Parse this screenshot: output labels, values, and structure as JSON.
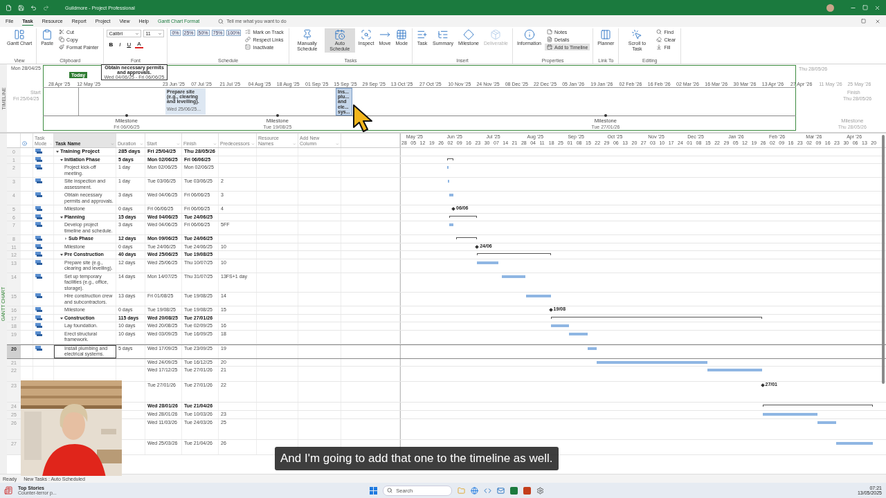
{
  "title_bar": {
    "title": "Guildmore - Project Professional"
  },
  "menu": [
    {
      "label": "File",
      "selected": false
    },
    {
      "label": "Task",
      "selected": true
    },
    {
      "label": "Resource",
      "selected": false
    },
    {
      "label": "Report",
      "selected": false
    },
    {
      "label": "Project",
      "selected": false
    },
    {
      "label": "View",
      "selected": false
    },
    {
      "label": "Help",
      "selected": false
    },
    {
      "label": "Gantt Chart Format",
      "selected": false
    }
  ],
  "tell_me": {
    "placeholder": "Tell me what you want to do"
  },
  "ribbon": [
    {
      "label": "View",
      "items": [
        {
          "kind": "large",
          "label": "Gantt Chart",
          "selected": false,
          "disabled": false
        }
      ]
    },
    {
      "label": "Clipboard",
      "items": [
        {
          "kind": "large",
          "label": "Paste",
          "selected": false,
          "disabled": false
        },
        {
          "kind": "small",
          "label": "Cut",
          "selected": false,
          "disabled": false
        },
        {
          "kind": "small",
          "label": "Copy",
          "selected": false,
          "disabled": false
        },
        {
          "kind": "small",
          "label": "Format Painter",
          "selected": false,
          "disabled": false
        }
      ]
    },
    {
      "label": "Font",
      "items": [
        {
          "kind": "field",
          "value": "Calibri"
        },
        {
          "kind": "field",
          "value": "11"
        },
        {
          "kind": "format",
          "label": "B"
        },
        {
          "kind": "format",
          "label": "I"
        },
        {
          "kind": "format",
          "label": "U"
        },
        {
          "kind": "format",
          "label": "A"
        }
      ]
    },
    {
      "label": "Schedule",
      "items": [
        {
          "kind": "pct",
          "label": "0%"
        },
        {
          "kind": "pct",
          "label": "25%"
        },
        {
          "kind": "pct",
          "label": "50%"
        },
        {
          "kind": "pct",
          "label": "75%"
        },
        {
          "kind": "pct",
          "label": "100%"
        },
        {
          "kind": "small",
          "label": "Mark on Track",
          "selected": false,
          "disabled": false
        },
        {
          "kind": "small",
          "label": "Respect Links",
          "selected": false,
          "disabled": false
        },
        {
          "kind": "small",
          "label": "Inactivate",
          "selected": false,
          "disabled": false
        }
      ]
    },
    {
      "label": "Tasks",
      "items": [
        {
          "kind": "large",
          "label": "Manually Schedule",
          "selected": false,
          "disabled": false
        },
        {
          "kind": "large",
          "label": "Auto Schedule",
          "selected": true,
          "disabled": false
        },
        {
          "kind": "large",
          "label": "Inspect",
          "selected": false,
          "disabled": false
        },
        {
          "kind": "large",
          "label": "Move",
          "selected": false,
          "disabled": false
        },
        {
          "kind": "large",
          "label": "Mode",
          "selected": false,
          "disabled": false
        }
      ]
    },
    {
      "label": "Insert",
      "items": [
        {
          "kind": "large",
          "label": "Task",
          "selected": false,
          "disabled": false
        },
        {
          "kind": "large",
          "label": "Summary",
          "selected": false,
          "disabled": false
        },
        {
          "kind": "large",
          "label": "Milestone",
          "selected": false,
          "disabled": false
        },
        {
          "kind": "large",
          "label": "Deliverable",
          "selected": false,
          "disabled": true
        }
      ]
    },
    {
      "label": "Properties",
      "items": [
        {
          "kind": "large",
          "label": "Information",
          "selected": false,
          "disabled": false
        },
        {
          "kind": "small",
          "label": "Notes",
          "selected": false,
          "disabled": false
        },
        {
          "kind": "small",
          "label": "Details",
          "selected": false,
          "disabled": false
        },
        {
          "kind": "small",
          "label": "Add to Timeline",
          "selected": true,
          "disabled": false
        }
      ]
    },
    {
      "label": "Link To",
      "items": [
        {
          "kind": "large",
          "label": "Planner",
          "selected": false,
          "disabled": false
        }
      ]
    },
    {
      "label": "Editing",
      "items": [
        {
          "kind": "large",
          "label": "Scroll to Task",
          "selected": false,
          "disabled": false
        },
        {
          "kind": "small",
          "label": "Find",
          "selected": false,
          "disabled": false
        },
        {
          "kind": "small",
          "label": "Clear",
          "selected": false,
          "disabled": false
        },
        {
          "kind": "small",
          "label": "Fill",
          "selected": false,
          "disabled": false
        }
      ]
    }
  ],
  "timeline": {
    "label": "TIMELINE",
    "top_start": "Mon 28/04/25",
    "top_finish": "Thu 28/05/26",
    "start_label": "Start",
    "start": "Fri 25/04/25",
    "finish_label": "Finish",
    "finish": "Thu 28/05/26",
    "today": "Today",
    "ticks": [
      "28 Apr '25",
      "12 May '25",
      "23 Jun '25",
      "07 Jul '25",
      "21 Jul '25",
      "04 Aug '25",
      "18 Aug '25",
      "01 Sep '25",
      "15 Sep '25",
      "29 Sep '25",
      "13 Oct '25",
      "27 Oct '25",
      "10 Nov '25",
      "24 Nov '25",
      "08 Dec '25",
      "22 Dec '25",
      "05 Jan '26",
      "19 Jan '26",
      "02 Feb '26",
      "16 Feb '26",
      "02 Mar '26",
      "16 Mar '26",
      "30 Mar '26",
      "13 Apr '26",
      "27 Apr '26",
      "11 May '26",
      "25 May '26"
    ],
    "callout": {
      "title": "Obtain necessary permits and approvals.",
      "dates": "Wed 04/06/25 - Fri 06/06/25"
    },
    "bars": [
      {
        "lines": [
          "Prepare site",
          "(e.g., clearing",
          "and levelling)."
        ],
        "dates": "Wed 25/06/25...",
        "selected": false
      },
      {
        "lines": [
          "Ins...",
          "plu...",
          "and",
          "ele...",
          "sys..."
        ],
        "selected": true
      }
    ],
    "milestones": [
      {
        "label": "Milestone",
        "date": "Fri 06/06/25",
        "faded": false
      },
      {
        "label": "Milestone",
        "date": "Tue 19/08/25",
        "faded": false
      },
      {
        "label": "Milestone",
        "date": "Tue 27/01/26",
        "faded": false
      },
      {
        "label": "Milestone",
        "date": "Thu 28/05/26",
        "faded": true
      }
    ]
  },
  "gantt": {
    "label": "GANTT CHART",
    "columns": [
      "Task Mode",
      "Task Name",
      "Duration",
      "Start",
      "Finish",
      "Predecessors",
      "Resource Names",
      "Add New Column"
    ],
    "months": [
      "May '25",
      "Jun '25",
      "Jul '25",
      "Aug '25",
      "Sep '25",
      "Oct '25",
      "Nov '25",
      "Dec '25",
      "Jan '26",
      "Feb '26",
      "Mar '26",
      "Apr '26"
    ],
    "weeks": [
      "28",
      "05",
      "12",
      "19",
      "26",
      "02",
      "09",
      "16",
      "23",
      "30",
      "07",
      "14",
      "21",
      "28",
      "04",
      "11",
      "18",
      "25",
      "01",
      "08",
      "15",
      "22",
      "29",
      "06",
      "13",
      "20",
      "27",
      "03",
      "10",
      "17",
      "24",
      "01",
      "08",
      "15",
      "22",
      "29",
      "05",
      "12",
      "19",
      "26",
      "02",
      "09",
      "16",
      "23",
      "02",
      "09",
      "16",
      "23",
      "30",
      "06",
      "13",
      "20"
    ],
    "rows": [
      {
        "id": "0",
        "kind": "summary",
        "name": "Training Project",
        "duration": "285 days",
        "start": "Fri 25/04/25",
        "finish": "Thu 28/05/26",
        "expanded": true,
        "selected": false,
        "children": [
          {
            "id": "1",
            "kind": "summary",
            "name": "Initiation Phase",
            "duration": "5 days",
            "start": "Mon 02/06/25",
            "finish": "Fri 06/06/25",
            "expanded": true,
            "selected": false,
            "children": [
              {
                "id": "2",
                "kind": "task",
                "name": "Project kick-off meeting.",
                "duration": "1 day",
                "start": "Mon 02/06/25",
                "finish": "Mon 02/06/25",
                "selected": false
              },
              {
                "id": "3",
                "kind": "task",
                "name": "Site inspection and assessment.",
                "duration": "1 day",
                "start": "Tue 03/06/25",
                "finish": "Tue 03/06/25",
                "predecessors": "2",
                "selected": false
              },
              {
                "id": "4",
                "kind": "task",
                "name": "Obtain necessary permits and approvals.",
                "duration": "3 days",
                "start": "Wed 04/06/25",
                "finish": "Fri 06/06/25",
                "predecessors": "3",
                "selected": false
              },
              {
                "id": "5",
                "kind": "milestone",
                "name": "Milestone",
                "duration": "0 days",
                "start": "Fri 06/06/25",
                "finish": "Fri 06/06/25",
                "predecessors": "4",
                "bar_label": "06/06",
                "selected": false
              }
            ]
          },
          {
            "id": "6",
            "kind": "summary",
            "name": "Planning",
            "duration": "15 days",
            "start": "Wed 04/06/25",
            "finish": "Tue 24/06/25",
            "expanded": true,
            "selected": false,
            "children": [
              {
                "id": "7",
                "kind": "task",
                "name": "Develop project timeline and schedule.",
                "duration": "3 days",
                "start": "Wed 04/06/25",
                "finish": "Fri 06/06/25",
                "predecessors": "5FF",
                "selected": false
              },
              {
                "id": "8",
                "kind": "summary",
                "name": "Sub Phase",
                "duration": "12 days",
                "start": "Mon 09/06/25",
                "finish": "Tue 24/06/25",
                "expanded": false,
                "selected": false
              },
              {
                "id": "11",
                "kind": "milestone",
                "name": "Milestone",
                "duration": "0 days",
                "start": "Tue 24/06/25",
                "finish": "Tue 24/06/25",
                "predecessors": "10",
                "bar_label": "24/06",
                "selected": false
              }
            ]
          },
          {
            "id": "12",
            "kind": "summary",
            "name": "Pre Construction",
            "duration": "40 days",
            "start": "Wed 25/06/25",
            "finish": "Tue 19/08/25",
            "expanded": true,
            "selected": false,
            "children": [
              {
                "id": "13",
                "kind": "task",
                "name": "Prepare site (e.g., clearing and levelling).",
                "duration": "12 days",
                "start": "Wed 25/06/25",
                "finish": "Thu 10/07/25",
                "predecessors": "10",
                "selected": false
              },
              {
                "id": "14",
                "kind": "task",
                "name": "Set up temporary facilities (e.g., office, storage).",
                "duration": "14 days",
                "start": "Mon 14/07/25",
                "finish": "Thu 31/07/25",
                "predecessors": "13FS+1 day",
                "selected": false
              },
              {
                "id": "15",
                "kind": "task",
                "name": "Hire construction crew and subcontractors.",
                "duration": "13 days",
                "start": "Fri 01/08/25",
                "finish": "Tue 19/08/25",
                "predecessors": "14",
                "selected": false
              },
              {
                "id": "16",
                "kind": "milestone",
                "name": "Milestone",
                "duration": "0 days",
                "start": "Tue 19/08/25",
                "finish": "Tue 19/08/25",
                "predecessors": "15",
                "bar_label": "19/08",
                "selected": false
              }
            ]
          },
          {
            "id": "17",
            "kind": "summary",
            "name": "Construction",
            "duration": "115 days",
            "start": "Wed 20/08/25",
            "finish": "Tue 27/01/26",
            "expanded": true,
            "selected": false,
            "children": [
              {
                "id": "18",
                "kind": "task",
                "name": "Lay foundation.",
                "duration": "10 days",
                "start": "Wed 20/08/25",
                "finish": "Tue 02/09/25",
                "predecessors": "16",
                "selected": false
              },
              {
                "id": "19",
                "kind": "task",
                "name": "Erect structural framework.",
                "duration": "10 days",
                "start": "Wed 03/09/25",
                "finish": "Tue 16/09/25",
                "predecessors": "18",
                "selected": false
              },
              {
                "id": "20",
                "kind": "task",
                "name": "Install plumbing and electrical systems.",
                "duration": "5 days",
                "start": "Wed 17/09/25",
                "finish": "Tue 23/09/25",
                "predecessors": "19",
                "selected": true
              },
              {
                "id": "21",
                "kind": "task",
                "start": "Wed 24/09/25",
                "finish": "Tue 16/12/25",
                "predecessors": "20",
                "selected": false
              },
              {
                "id": "22",
                "kind": "task",
                "start": "Wed 17/12/25",
                "finish": "Tue 27/01/26",
                "predecessors": "21",
                "selected": false
              },
              {
                "id": "23",
                "kind": "milestone",
                "start": "Tue 27/01/26",
                "finish": "Tue 27/01/26",
                "predecessors": "22",
                "bar_label": "27/01",
                "selected": false
              }
            ]
          },
          {
            "id": "24",
            "kind": "summary",
            "start": "Wed 28/01/26",
            "finish": "Tue 21/04/26",
            "selected": false,
            "children": [
              {
                "id": "25",
                "kind": "task",
                "start": "Wed 28/01/26",
                "finish": "Tue 10/03/26",
                "predecessors": "23",
                "selected": false
              },
              {
                "id": "26",
                "kind": "task",
                "start": "Wed 11/03/26",
                "finish": "Tue 24/03/26",
                "predecessors": "25",
                "selected": false
              },
              {
                "id": "27",
                "kind": "task",
                "start": "Wed 25/03/26",
                "finish": "Tue 21/04/26",
                "predecessors": "26",
                "selected": false
              }
            ]
          }
        ]
      }
    ]
  },
  "subtitle": "And I'm going to add that one to the timeline as well.",
  "status_bar": {
    "state": "Ready",
    "new_tasks": "New Tasks : Auto Scheduled"
  },
  "taskbar": {
    "news_title": "Top Stories",
    "news_text": "Counter-terror p...",
    "search": {
      "placeholder": "Search"
    },
    "time": "07:21",
    "date": "13/05/2025"
  }
}
